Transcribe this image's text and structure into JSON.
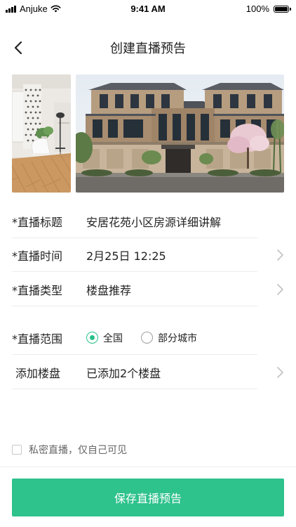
{
  "status_bar": {
    "carrier": "Anjuke",
    "time": "9:41 AM",
    "battery": "100%",
    "battery_level": 1.0,
    "icons": [
      "signal-icon",
      "wifi-icon",
      "battery-icon"
    ]
  },
  "nav": {
    "title": "创建直播预告",
    "back_icon": "chevron-left-icon"
  },
  "photos": [
    {
      "subject": "living room interior"
    },
    {
      "subject": "villa exterior"
    }
  ],
  "form": {
    "title": {
      "label": "*直播标题",
      "value": "安居花苑小区房源详细讲解"
    },
    "time": {
      "label": "*直播时间",
      "value": "2月25日 12:25"
    },
    "type": {
      "label": "*直播类型",
      "value": "楼盘推荐"
    },
    "scope": {
      "label": "*直播范围",
      "options": [
        {
          "label": "全国",
          "selected": true
        },
        {
          "label": "部分城市",
          "selected": false
        }
      ]
    },
    "building": {
      "label": "添加楼盘",
      "value": "已添加2个楼盘"
    }
  },
  "privacy": {
    "label": "私密直播，仅自己可见",
    "checked": false
  },
  "save_button": {
    "label": "保存直播预告"
  },
  "colors": {
    "accent": "#2ec28d",
    "radio_active": "#27c08a",
    "divider": "#ececec",
    "chevron": "#c2c2c2",
    "muted_text": "#666666"
  }
}
